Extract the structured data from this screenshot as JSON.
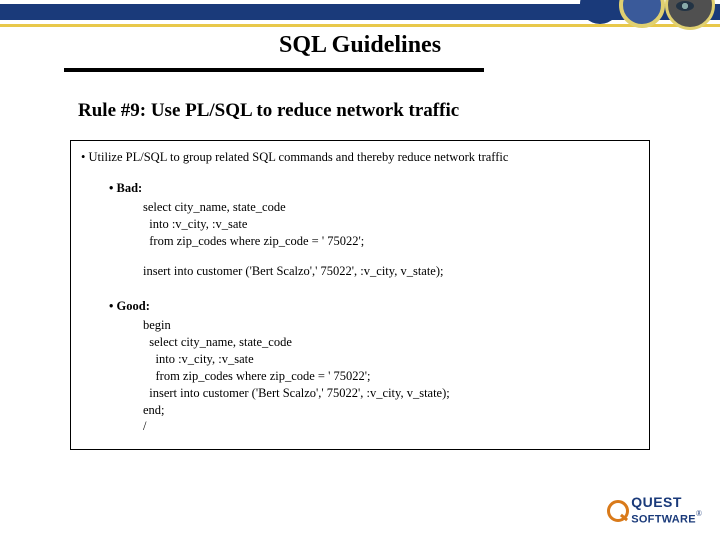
{
  "title": "SQL Guidelines",
  "rule": "Rule #9: Use PL/SQL to reduce network traffic",
  "lead": "Utilize PL/SQL to group related SQL commands and thereby reduce network traffic",
  "bad": {
    "label": "Bad:",
    "code1": "select city_name, state_code\n  into :v_city, :v_sate\n  from zip_codes where zip_code = ' 75022';",
    "code2": "insert into customer ('Bert Scalzo',' 75022', :v_city, v_state);"
  },
  "good": {
    "label": "Good:",
    "code": "begin\n  select city_name, state_code\n    into :v_city, :v_sate\n    from zip_codes where zip_code = ' 75022';\n  insert into customer ('Bert Scalzo',' 75022', :v_city, v_state);\nend;\n/"
  },
  "logo": {
    "top": "QUEST",
    "bottom": "SOFTWARE"
  }
}
